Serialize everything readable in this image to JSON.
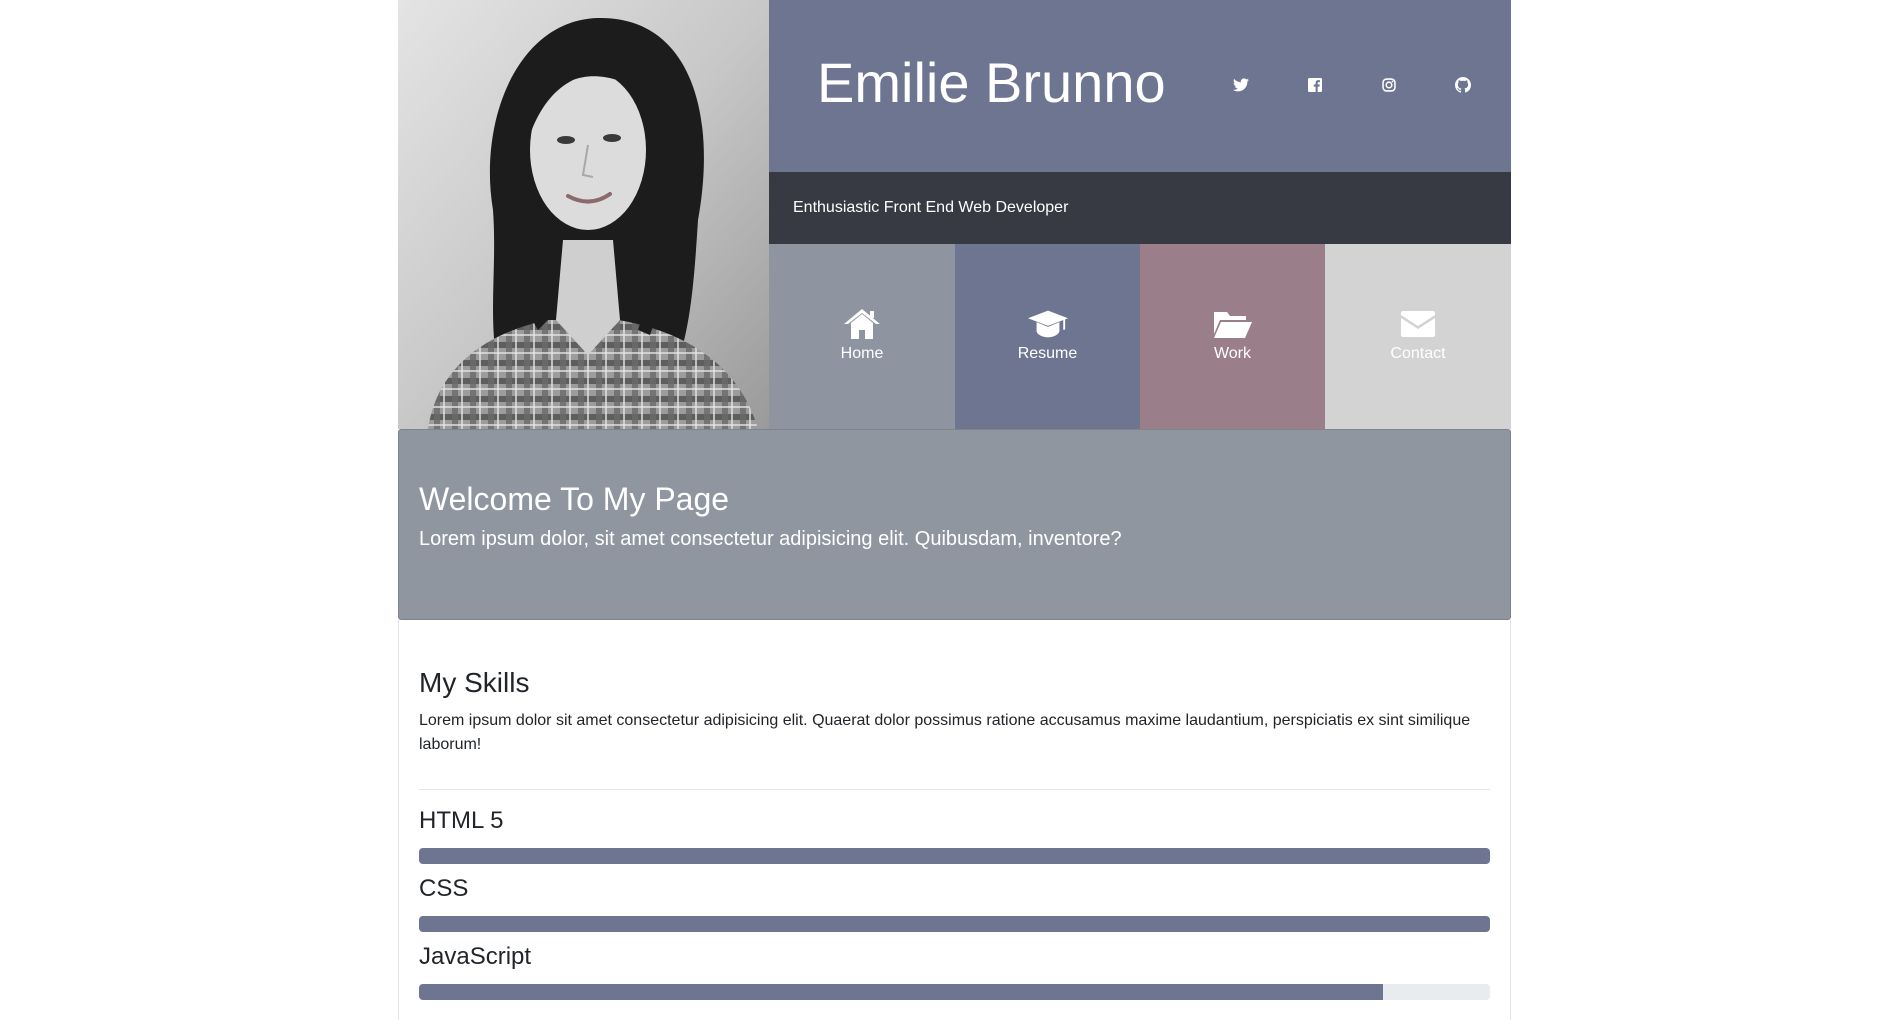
{
  "profile": {
    "name": "Emilie Brunno",
    "tagline": "Enthusiastic Front End Web Developer"
  },
  "social": [
    {
      "icon": "twitter-icon"
    },
    {
      "icon": "facebook-icon"
    },
    {
      "icon": "instagram-icon"
    },
    {
      "icon": "github-icon"
    }
  ],
  "nav": [
    {
      "label": "Home",
      "icon": "home-icon",
      "color": "#8e95a0"
    },
    {
      "label": "Resume",
      "icon": "graduation-cap-icon",
      "color": "#6e7591"
    },
    {
      "label": "Work",
      "icon": "folder-open-icon",
      "color": "#9a7f8b"
    },
    {
      "label": "Contact",
      "icon": "envelope-icon",
      "color": "#d3d3d3"
    }
  ],
  "welcome": {
    "title": "Welcome To My Page",
    "text": "Lorem ipsum dolor, sit amet consectetur adipisicing elit. Quibusdam, inventore?"
  },
  "skills": {
    "title": "My Skills",
    "text": "Lorem ipsum dolor sit amet consectetur adipisicing elit. Quaerat dolor possimus ratione accusamus maxime laudantium, perspiciatis ex sint similique laborum!",
    "items": [
      {
        "name": "HTML 5",
        "level": 1.0
      },
      {
        "name": "CSS",
        "level": 1.0
      },
      {
        "name": "JavaScript",
        "level": 0.9
      }
    ]
  },
  "colors": {
    "accent": "#6e7591",
    "dark": "#373a43",
    "welcome_bg": "#8f96a0",
    "progress_track": "#e9ecef"
  }
}
